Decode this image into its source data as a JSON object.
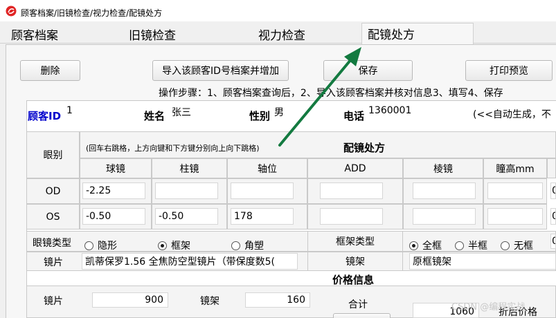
{
  "window": {
    "title": "顾客档案/旧镜检查/视力检查/配镜处方"
  },
  "tabs": [
    {
      "label": "顾客档案"
    },
    {
      "label": "旧镜检查"
    },
    {
      "label": "视力检查"
    },
    {
      "label": "配镜处方"
    }
  ],
  "toolbar": {
    "delete": "删除",
    "import": "导入该顾客ID号档案并增加",
    "save": "保存",
    "print": "打印预览"
  },
  "steps_text": "操作步骤：1、顾客档案查询后，2、导入该顾客档案并核对信息3、填写4、保存",
  "customer": {
    "id_label": "顾客ID",
    "id_value": "1",
    "name_label": "姓名",
    "name_value": "张三",
    "gender_label": "性别",
    "gender_value": "男",
    "phone_label": "电话",
    "phone_value": "1360001",
    "auto_note": "(<<自动生成，不"
  },
  "prescription": {
    "eye_label": "眼别",
    "hint": "(回车右跳格，上方向键和下方键分别向上向下跳格)",
    "title": "配镜处方",
    "columns": [
      "球镜",
      "柱镜",
      "轴位",
      "ADD",
      "棱镜",
      "瞳高mm"
    ],
    "rows": [
      {
        "label": "OD",
        "values": [
          "-2.25",
          "",
          "",
          "",
          "",
          ""
        ],
        "extra": "0"
      },
      {
        "label": "OS",
        "values": [
          "-0.50",
          "-0.50",
          "178",
          "",
          "",
          ""
        ],
        "extra": "0"
      }
    ]
  },
  "glasses_type": {
    "label": "眼镜类型",
    "options": [
      {
        "label": "隐形",
        "selected": false
      },
      {
        "label": "框架",
        "selected": true
      },
      {
        "label": "角塑",
        "selected": false
      }
    ]
  },
  "frame_type": {
    "label": "框架类型",
    "options": [
      {
        "label": "全框",
        "selected": true
      },
      {
        "label": "半框",
        "selected": false
      },
      {
        "label": "无框",
        "selected": false
      }
    ],
    "extra": "0"
  },
  "lens": {
    "label": "镜片",
    "value": "凯蒂保罗1.56 全焦防空型镜片（带保度数5("
  },
  "frame": {
    "label": "镜架",
    "value": "原框镜架"
  },
  "price": {
    "title": "价格信息",
    "lens_label": "镜片",
    "lens_value": "900",
    "frame_label": "镜架",
    "frame_value": "160",
    "total_label": "合计",
    "total_value": "1060",
    "discount_label": "折后价格"
  },
  "watermark": "CSDN @编程实战",
  "colors": {
    "arrow": "#137a40",
    "id_label": "#0000cc"
  }
}
